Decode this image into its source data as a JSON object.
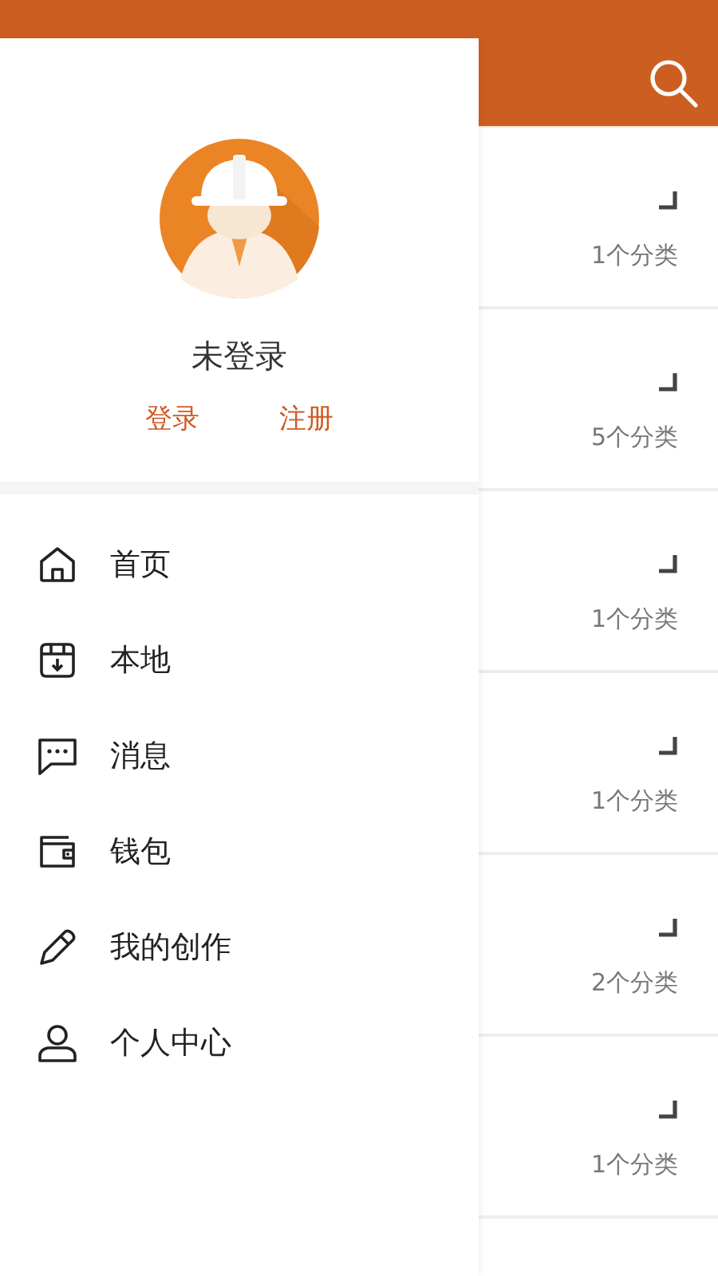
{
  "drawer": {
    "user_name": "未登录",
    "actions": [
      {
        "label": "登录"
      },
      {
        "label": "注册"
      }
    ],
    "menu": [
      {
        "label": "首页"
      },
      {
        "label": "本地"
      },
      {
        "label": "消息"
      },
      {
        "label": "钱包"
      },
      {
        "label": "我的创作"
      },
      {
        "label": "个人中心"
      }
    ]
  },
  "list": {
    "rows": [
      {
        "count": "1个分类"
      },
      {
        "count": "5个分类"
      },
      {
        "count": "1个分类"
      },
      {
        "count": "1个分类"
      },
      {
        "count": "2个分类"
      },
      {
        "count": "1个分类"
      }
    ]
  }
}
